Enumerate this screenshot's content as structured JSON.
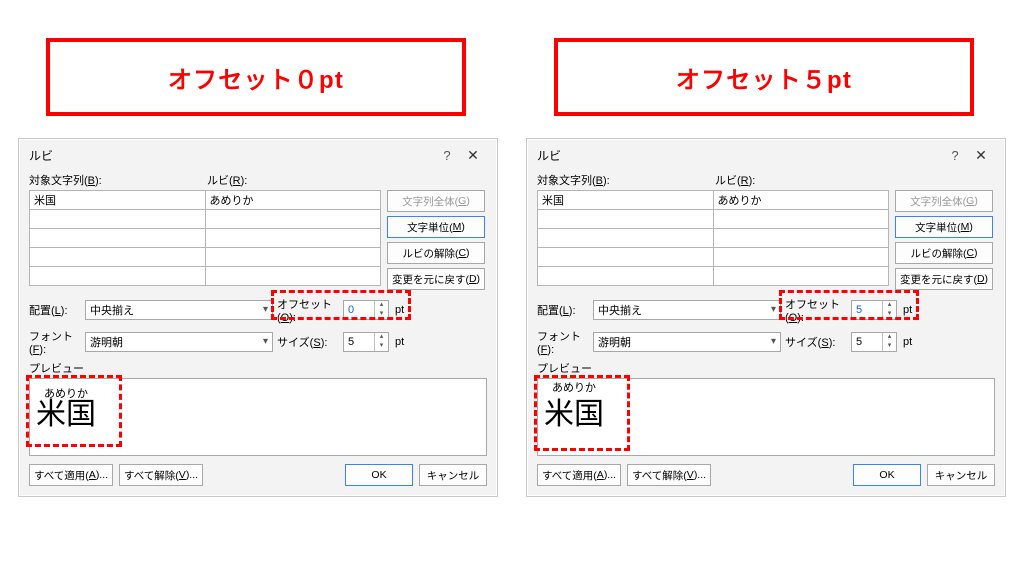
{
  "titles": {
    "left": "オフセット０pt",
    "right": "オフセット５pt"
  },
  "dialog": {
    "title": "ルビ",
    "help": "?",
    "close": "✕",
    "target_label_pre": "対象文字列(",
    "target_label_accel": "B",
    "target_label_post": "):",
    "ruby_label_pre": "ルビ(",
    "ruby_label_accel": "R",
    "ruby_label_post": "):",
    "row_target": "米国",
    "row_ruby": "あめりか",
    "btn_whole_pre": "文字列全体(",
    "btn_whole_accel": "G",
    "btn_whole_post": ")",
    "btn_char_pre": "文字単位(",
    "btn_char_accel": "M",
    "btn_char_post": ")",
    "btn_clear_pre": "ルビの解除(",
    "btn_clear_accel": "C",
    "btn_clear_post": ")",
    "btn_revert_pre": "変更を元に戻す(",
    "btn_revert_accel": "D",
    "btn_revert_post": ")",
    "align_label_pre": "配置(",
    "align_label_accel": "L",
    "align_label_post": "):",
    "align_value": "中央揃え",
    "offset_label_pre": "オフセット(",
    "offset_label_accel": "O",
    "offset_label_post": "):",
    "offset_left": "0",
    "offset_right": "5",
    "pt": "pt",
    "font_label_pre": "フォント(",
    "font_label_accel": "F",
    "font_label_post": "):",
    "font_value": "游明朝",
    "size_label_pre": "サイズ(",
    "size_label_accel": "S",
    "size_label_post": "):",
    "size_value": "5",
    "preview_label": "プレビュー",
    "preview_furi": "あめりか",
    "preview_base": "米国",
    "apply_all_pre": "すべて適用(",
    "apply_all_accel": "A",
    "apply_all_post": ")...",
    "clear_all_pre": "すべて解除(",
    "clear_all_accel": "V",
    "clear_all_post": ")...",
    "ok": "OK",
    "cancel": "キャンセル"
  }
}
